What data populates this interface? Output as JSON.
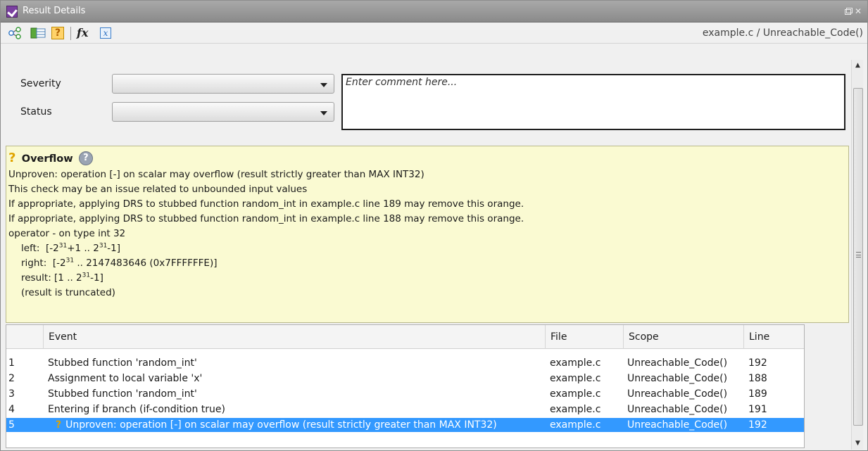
{
  "window": {
    "title": "Result Details"
  },
  "toolbar": {
    "fx_label": "fx",
    "help_label": "?",
    "var_label": "x",
    "path": "example.c / Unreachable_Code()"
  },
  "form": {
    "severity_label": "Severity",
    "status_label": "Status",
    "severity_value": "",
    "status_value": "",
    "comment_placeholder": "Enter comment here..."
  },
  "detail": {
    "title": "Overflow",
    "help_label": "?",
    "lines": [
      "Unproven: operation [-] on scalar may overflow (result strictly greater than MAX INT32)",
      "This check may be an issue related to unbounded input values",
      "If appropriate, applying DRS to stubbed function random_int in example.c line 189 may remove this orange.",
      "If appropriate, applying DRS to stubbed function random_int in example.c line 188 may remove this orange.",
      "operator - on type int 32"
    ],
    "left_label": "left:",
    "right_label": "right:",
    "result_label": "result:",
    "truncated_note": "(result is truncated)"
  },
  "table": {
    "columns": [
      "Event",
      "File",
      "Scope",
      "Line"
    ],
    "rows": [
      {
        "num": "1",
        "event": "Stubbed function 'random_int'",
        "file": "example.c",
        "scope": "Unreachable_Code()",
        "line": "192"
      },
      {
        "num": "2",
        "event": "Assignment to local variable 'x'",
        "file": "example.c",
        "scope": "Unreachable_Code()",
        "line": "188"
      },
      {
        "num": "3",
        "event": "Stubbed function 'random_int'",
        "file": "example.c",
        "scope": "Unreachable_Code()",
        "line": "189"
      },
      {
        "num": "4",
        "event": "Entering if branch (if-condition true)",
        "file": "example.c",
        "scope": "Unreachable_Code()",
        "line": "191"
      },
      {
        "num": "5",
        "event": "Unproven: operation [-] on scalar may overflow (result strictly greater than MAX INT32)",
        "file": "example.c",
        "scope": "Unreachable_Code()",
        "line": "192"
      }
    ]
  },
  "colors": {
    "selection": "#3399ff",
    "detail_background": "#fafad2",
    "warning_icon": "#e0a400"
  }
}
